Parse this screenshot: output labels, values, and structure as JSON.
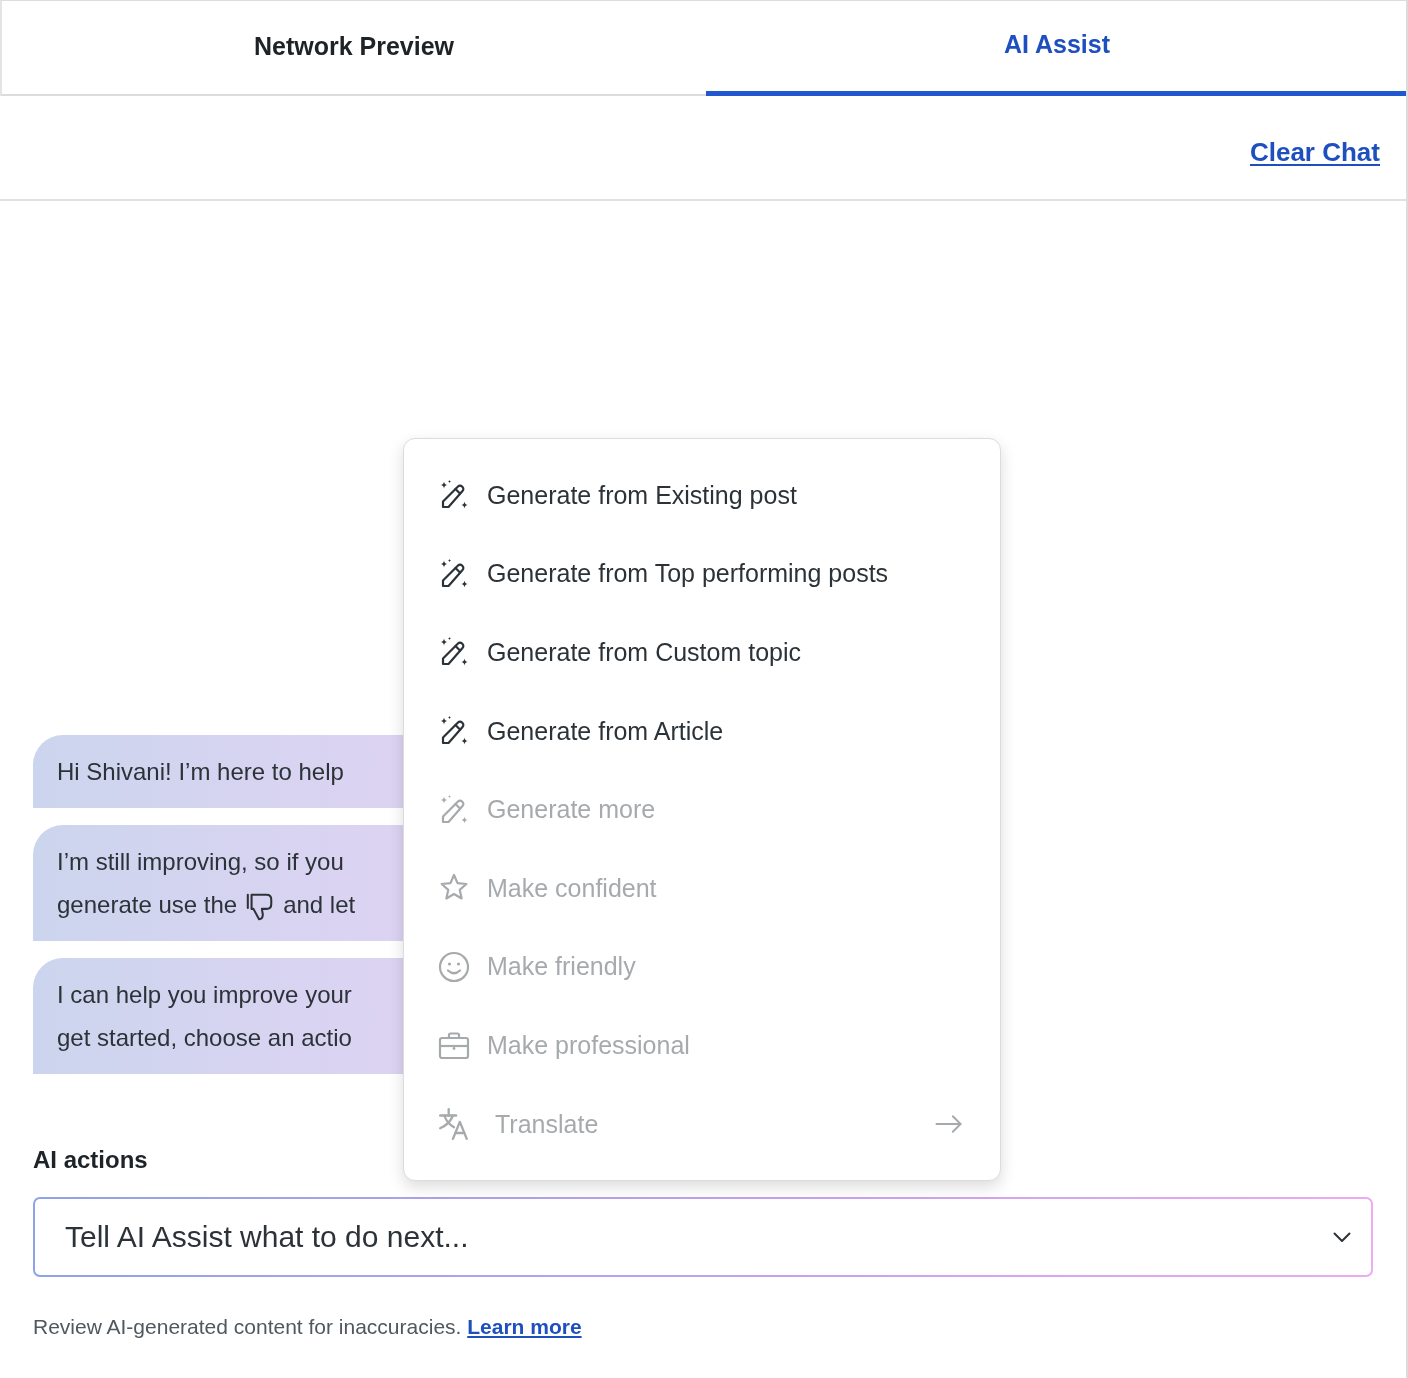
{
  "tabs": [
    {
      "label": "Network Preview",
      "selected": false
    },
    {
      "label": "AI Assist",
      "selected": true
    }
  ],
  "toolbar": {
    "clear_chat": "Clear Chat"
  },
  "messages": [
    {
      "lines": [
        {
          "kind": "text",
          "text": "Hi Shivani! I’m here to help"
        }
      ]
    },
    {
      "lines": [
        {
          "kind": "text",
          "text": "I’m still improving, so if you"
        },
        {
          "kind": "feedback",
          "before": "generate use the",
          "after": "and let"
        }
      ]
    },
    {
      "lines": [
        {
          "kind": "text",
          "text": "I can help you improve your"
        },
        {
          "kind": "text",
          "text": "get started, choose an actio"
        }
      ]
    }
  ],
  "action_menu": {
    "items": [
      {
        "kind": "generate",
        "label": "Generate from Existing post",
        "disabled": false
      },
      {
        "kind": "generate",
        "label": "Generate from Top performing posts",
        "disabled": false
      },
      {
        "kind": "generate",
        "label": "Generate from Custom topic",
        "disabled": false
      },
      {
        "kind": "generate",
        "label": "Generate from Article",
        "disabled": false
      },
      {
        "kind": "generate",
        "label": "Generate more",
        "disabled": true
      },
      {
        "kind": "confident",
        "label": "Make confident",
        "disabled": true
      },
      {
        "kind": "friendly",
        "label": "Make friendly",
        "disabled": true
      },
      {
        "kind": "professional",
        "label": "Make professional",
        "disabled": true
      },
      {
        "kind": "translate",
        "label": "Translate",
        "disabled": true
      }
    ]
  },
  "ai_actions": {
    "label": "AI actions",
    "prompt": "Tell AI Assist what to do next..."
  },
  "disclaimer": {
    "text": "Review AI-generated content for inaccuracies.",
    "link": "Learn more"
  }
}
